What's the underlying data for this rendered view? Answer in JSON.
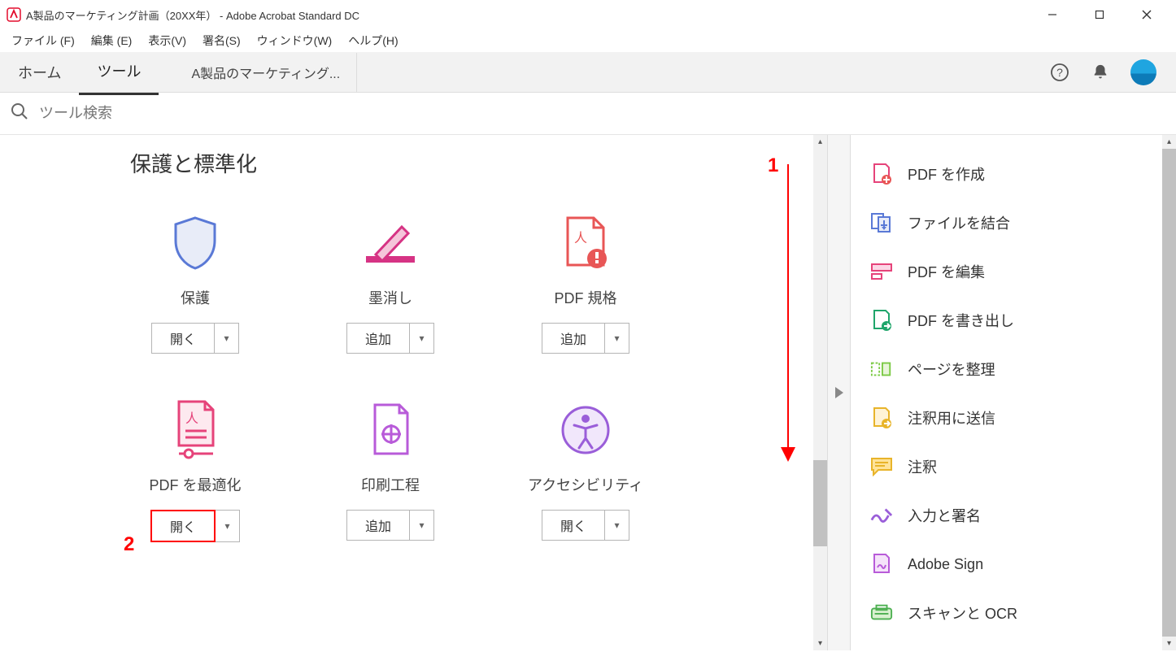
{
  "window": {
    "title": "A製品のマーケティング計画（20XX年） - Adobe Acrobat Standard DC"
  },
  "menu": {
    "file": "ファイル (F)",
    "edit": "編集 (E)",
    "view": "表示(V)",
    "sign": "署名(S)",
    "window": "ウィンドウ(W)",
    "help": "ヘルプ(H)"
  },
  "tabs": {
    "home": "ホーム",
    "tools": "ツール",
    "doc": "A製品のマーケティング..."
  },
  "search": {
    "placeholder": "ツール検索"
  },
  "section": {
    "title": "保護と標準化"
  },
  "tools": {
    "protect": {
      "label": "保護",
      "btn": "開く"
    },
    "redact": {
      "label": "墨消し",
      "btn": "追加"
    },
    "standards": {
      "label": "PDF 規格",
      "btn": "追加"
    },
    "optimize": {
      "label": "PDF を最適化",
      "btn": "開く"
    },
    "print": {
      "label": "印刷工程",
      "btn": "追加"
    },
    "accessibility": {
      "label": "アクセシビリティ",
      "btn": "開く"
    }
  },
  "rpanel": {
    "create": "PDF を作成",
    "combine": "ファイルを結合",
    "edit": "PDF を編集",
    "export": "PDF を書き出し",
    "organize": "ページを整理",
    "sendcomments": "注釈用に送信",
    "comment": "注釈",
    "fillsign": "入力と署名",
    "adobesign": "Adobe Sign",
    "scan": "スキャンと OCR"
  },
  "annotations": {
    "one": "1",
    "two": "2"
  }
}
